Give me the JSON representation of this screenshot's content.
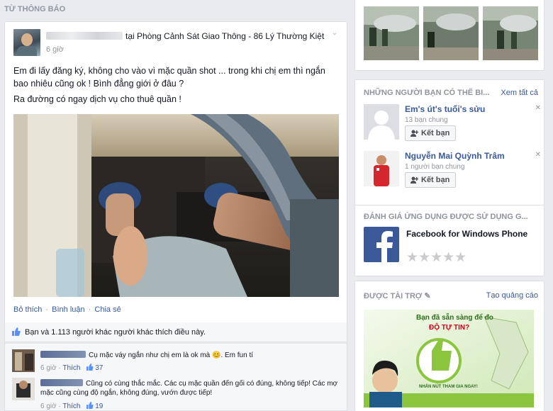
{
  "feed": {
    "section_title": "TỪ THÔNG BÁO",
    "post": {
      "location_text": "tại Phòng Cảnh Sát Giao Thông - 86 Lý Thường Kiệt",
      "time": "6 giờ",
      "paragraphs": [
        "Em đi lấy đăng ký, không cho vào vì mặc quần shot ... trong khi chị em thì ngắn bao nhiêu cũng ok ! Bình đẳng giới ở đâu ?",
        "Ra đường có ngay dịch vụ cho thuê quần !"
      ],
      "actions": {
        "like": "Bỏ thích",
        "comment": "Bình luận",
        "share": "Chia sẻ"
      },
      "likes_summary": "Bạn và 1.113 người khác người khác thích điều này.",
      "comments": [
        {
          "text": "Cụ mặc váy ngắn như chị em là ok mà 😊. Em fun tí",
          "time": "6 giờ",
          "like_label": "Thích",
          "likes": "37"
        },
        {
          "text": "Cũng có cùng thắc mắc. Các cụ mặc quần đến gối có đúng, không tiếp! Các mợ mặc cũng cùng độ ngắn, không đúng, vướn được tiếp!",
          "time": "6 giờ",
          "like_label": "Thích",
          "likes": "19"
        }
      ]
    }
  },
  "sidebar": {
    "people_you_may_know": {
      "title": "NHỮNG NGƯỜI BẠN CÓ THỂ BI...",
      "see_all": "Xem tất cả",
      "people": [
        {
          "name": "Em's út's tuổi's sửu",
          "mutual": "13 bạn chung",
          "button": "Kết bạn"
        },
        {
          "name": "Nguyễn Mai Quỳnh Trâm",
          "mutual": "1 người bạn chung",
          "button": "Kết bạn"
        }
      ]
    },
    "rate_app": {
      "title": "ĐÁNH GIÁ ỨNG DỤNG ĐƯỢC SỬ DỤNG G...",
      "app_name": "Facebook for Windows Phone",
      "stars": "★★★★★"
    },
    "sponsored": {
      "title": "ĐƯỢC TÀI TRỢ",
      "create_ad": "Tạo quảng cáo",
      "ad_headline": "Bạn đã sẵn sàng để đo",
      "ad_highlight": "ĐỘ TỰ TIN?",
      "ad_cta": "NHẤN NÚT THAM GIA NGAY!"
    }
  },
  "colors": {
    "link": "#3b5998",
    "meta": "#90949c",
    "background": "#e9ebee"
  }
}
